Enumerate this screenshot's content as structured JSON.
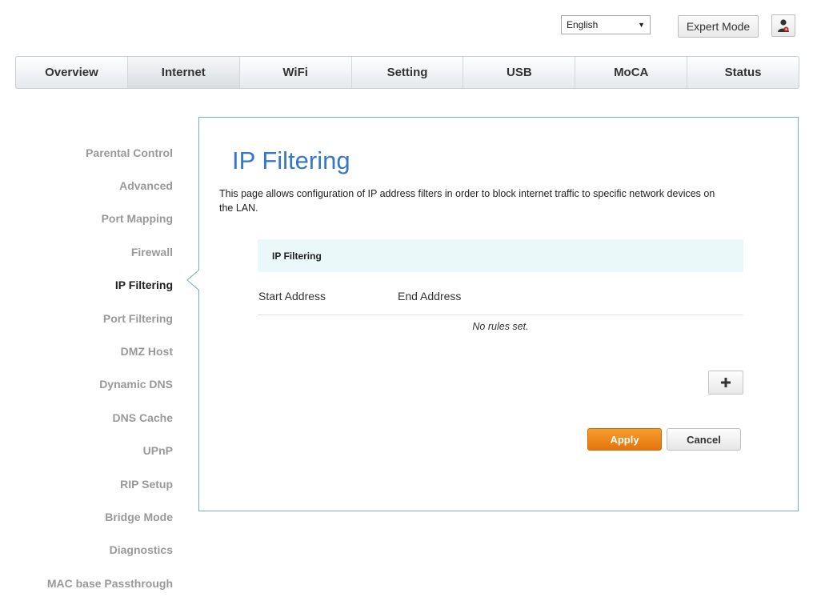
{
  "header": {
    "language": "English",
    "expert_mode_label": "Expert Mode",
    "user_icon": "user-settings-icon"
  },
  "nav": {
    "tabs": [
      {
        "label": "Overview"
      },
      {
        "label": "Internet",
        "active": true
      },
      {
        "label": "WiFi"
      },
      {
        "label": "Setting"
      },
      {
        "label": "USB"
      },
      {
        "label": "MoCA"
      },
      {
        "label": "Status"
      }
    ]
  },
  "sidebar": {
    "items": [
      {
        "label": "Parental Control"
      },
      {
        "label": "Advanced"
      },
      {
        "label": "Port Mapping"
      },
      {
        "label": "Firewall"
      },
      {
        "label": "IP Filtering",
        "active": true
      },
      {
        "label": "Port Filtering"
      },
      {
        "label": "DMZ Host"
      },
      {
        "label": "Dynamic DNS"
      },
      {
        "label": "DNS Cache"
      },
      {
        "label": "UPnP"
      },
      {
        "label": "RIP Setup"
      },
      {
        "label": "Bridge Mode"
      },
      {
        "label": "Diagnostics"
      },
      {
        "label": "MAC base Passthrough"
      }
    ]
  },
  "main": {
    "title": "IP Filtering",
    "description": "This page allows configuration of IP address filters in order to block internet traffic to specific network devices on the LAN.",
    "section_title": "IP Filtering",
    "columns": [
      "Start Address",
      "End Address"
    ],
    "empty_message": "No rules set.",
    "add_icon": "plus-icon",
    "apply_label": "Apply",
    "cancel_label": "Cancel"
  },
  "colors": {
    "accent_blue": "#3577c9",
    "apply_orange": "#e4750b",
    "panel_border": "#7aa9c9",
    "section_bg": "#eaf8fa"
  }
}
